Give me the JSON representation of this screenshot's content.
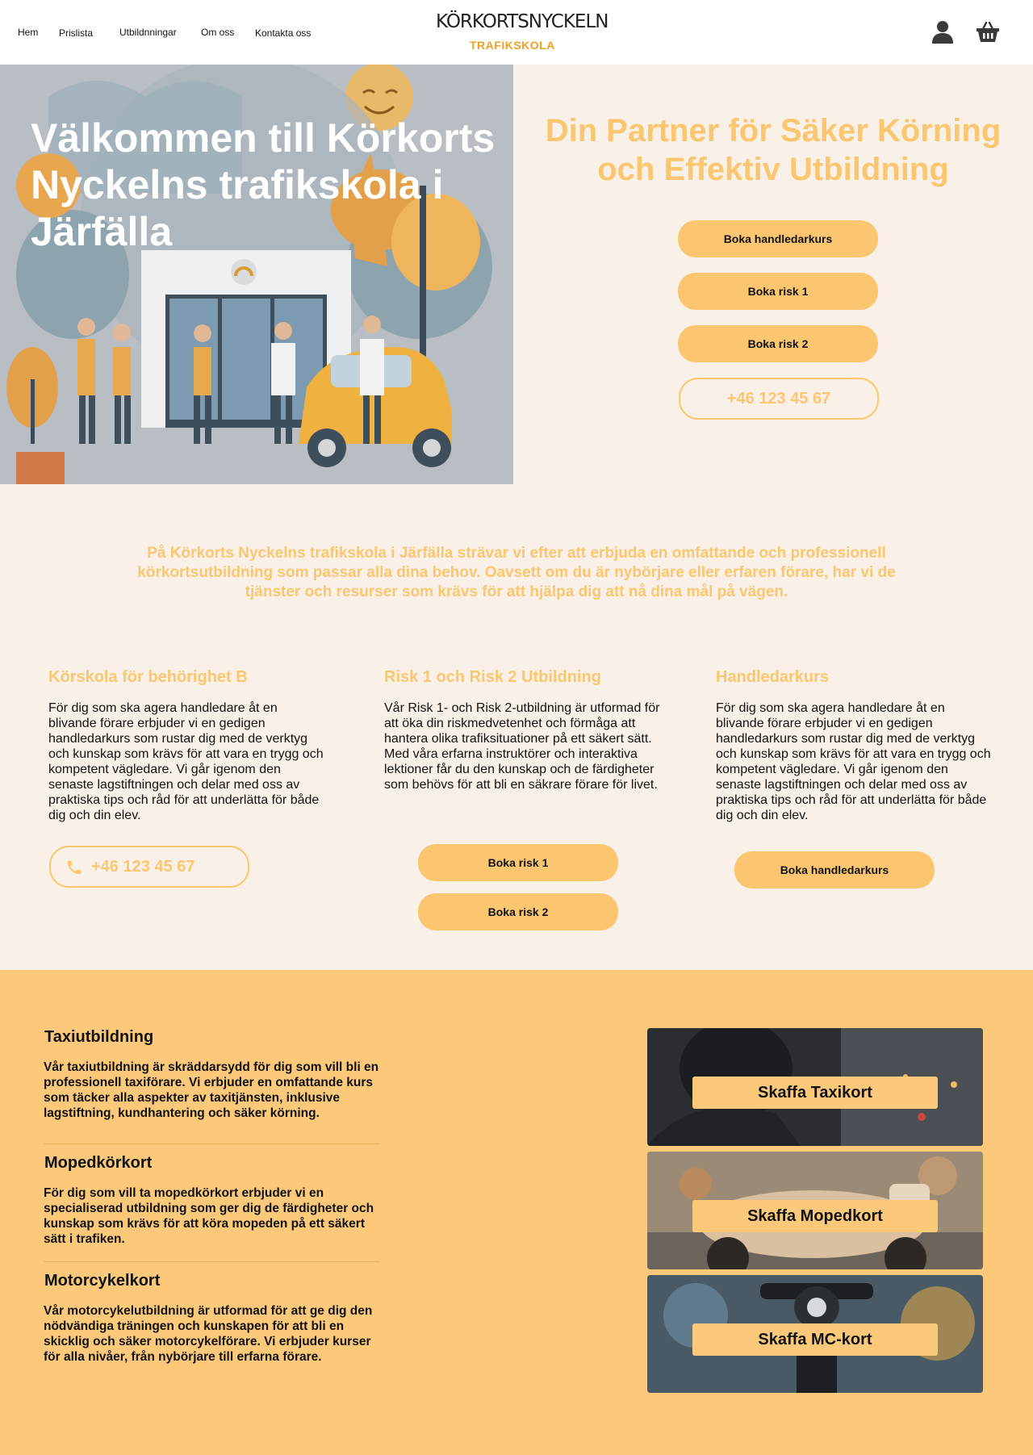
{
  "nav": {
    "items": [
      "Hem",
      "Prislista",
      "Utbildnningar",
      "Om oss",
      "Kontakta oss"
    ]
  },
  "logo": {
    "name": "KÖRKORTSNYCKELN",
    "sub": "TRAFIKSKOLA"
  },
  "hero": {
    "title": "Välkommen till Körkorts Nyckelns trafikskola i Järfälla",
    "partner_title": "Din Partner för Säker Körning och Effektiv Utbildning",
    "buttons": [
      "Boka handledarkurs",
      "Boka risk 1",
      "Boka risk 2"
    ],
    "phone": "+46 123 45 67"
  },
  "intro": "På Körkorts Nyckelns trafikskola i Järfälla strävar vi efter att erbjuda en omfattande och professionell körkortsutbildning som passar alla dina behov. Oavsett om du är nybörjare eller erfaren förare, har vi de tjänster och resurser som krävs för att hjälpa dig att nå dina mål på vägen.",
  "columns": [
    {
      "title": "Körskola för behörighet B",
      "text": "För dig som ska agera handledare åt en blivande förare erbjuder vi en gedigen handledarkurs som rustar dig med de verktyg och kunskap som krävs för att vara en trygg och kompetent vägledare. Vi går igenom den senaste lagstiftningen och delar med oss av praktiska tips och råd för att underlätta för både dig och din elev.",
      "phone": "+46 123 45 67"
    },
    {
      "title": "Risk 1 och Risk 2 Utbildning",
      "text": "Vår Risk 1- och Risk 2-utbildning är utformad för att öka din riskmedvetenhet och förmåga att hantera olika trafiksituationer på ett säkert sätt. Med våra erfarna instruktörer och interaktiva lektioner får du den kunskap och de färdigheter som behövs för att bli en säkrare förare för livet.",
      "buttons": [
        "Boka risk 1",
        "Boka risk 2"
      ]
    },
    {
      "title": "Handledarkurs",
      "text": "För dig som ska agera handledare åt en blivande förare erbjuder vi en gedigen handledarkurs som rustar dig med de verktyg och kunskap som krävs för att vara en trygg och kompetent vägledare. Vi går igenom den senaste lagstiftningen och delar med oss av praktiska tips och råd för att underlätta för både dig och din elev.",
      "button": "Boka handledarkurs"
    }
  ],
  "services": [
    {
      "title": "Taxiutbildning",
      "text": "Vår taxiutbildning är skräddarsydd för dig som vill bli en professionell taxiförare. Vi erbjuder en omfattande kurs som täcker alla aspekter av taxitjänsten, inklusive lagstiftning, kundhantering och säker körning."
    },
    {
      "title": "Mopedkörkort",
      "text": "För dig som vill ta mopedkörkort erbjuder vi en specialiserad utbildning som ger dig de färdigheter och kunskap som krävs för att köra mopeden på ett säkert sätt i trafiken."
    },
    {
      "title": "Motorcykelkort",
      "text": "Vår motorcykelutbildning är utformad för att ge dig den nödvändiga träningen och kunskapen för att bli en skicklig och säker motorcykelförare. Vi erbjuder kurser för alla nivåer, från nybörjare till erfarna förare."
    }
  ],
  "cards": [
    "Skaffa Taxikort",
    "Skaffa Mopedkort",
    "Skaffa MC-kort"
  ],
  "colors": {
    "accent": "#fcc670",
    "cream": "#f9f1e8",
    "yellow": "#fcc97a"
  }
}
